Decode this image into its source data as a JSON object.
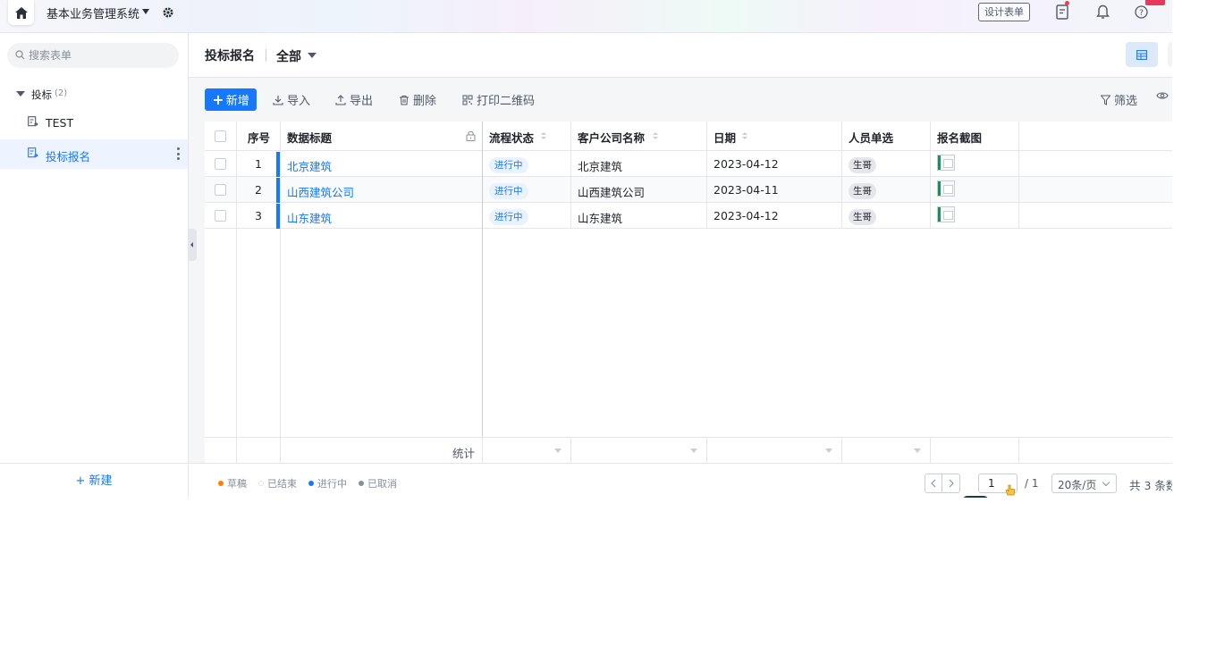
{
  "topbar": {
    "app_name": "基本业务管理系统",
    "design_button": "设计表单",
    "icons": [
      "home-icon",
      "gear-icon",
      "form-notice-icon",
      "bell-icon",
      "help-icon"
    ]
  },
  "sidebar": {
    "search_placeholder": "搜索表单",
    "group": {
      "label": "投标",
      "count": "(2)"
    },
    "items": [
      {
        "label": "TEST",
        "active": false
      },
      {
        "label": "投标报名",
        "active": true
      }
    ],
    "new_button": "+ 新建"
  },
  "header": {
    "title": "投标报名",
    "view": "全部"
  },
  "toolbar": {
    "add": "新增",
    "import": "导入",
    "export": "导出",
    "delete": "删除",
    "print_qr": "打印二维码",
    "filter": "筛选"
  },
  "table": {
    "columns": [
      "序号",
      "数据标题",
      "流程状态",
      "客户公司名称",
      "日期",
      "人员单选",
      "报名截图"
    ],
    "rows": [
      {
        "no": "1",
        "title": "北京建筑",
        "status": "进行中",
        "company": "北京建筑",
        "date": "2023-04-12",
        "person": "生哥"
      },
      {
        "no": "2",
        "title": "山西建筑公司",
        "status": "进行中",
        "company": "山西建筑公司",
        "date": "2023-04-11",
        "person": "生哥"
      },
      {
        "no": "3",
        "title": "山东建筑",
        "status": "进行中",
        "company": "山东建筑",
        "date": "2023-04-12",
        "person": "生哥"
      }
    ],
    "footer_label": "统计"
  },
  "statusbar": {
    "legend": [
      {
        "label": "草稿",
        "color": "#ff7d00"
      },
      {
        "label": "已结束",
        "color": "#ffffff"
      },
      {
        "label": "进行中",
        "color": "#1677ff"
      },
      {
        "label": "已取消",
        "color": "#86909c"
      }
    ],
    "page": "1",
    "total_pages": "/ 1",
    "page_size": "20条/页",
    "count": "共 3 条数"
  },
  "colors": {
    "accent": "#1677ff",
    "border": "#e5e6eb"
  }
}
